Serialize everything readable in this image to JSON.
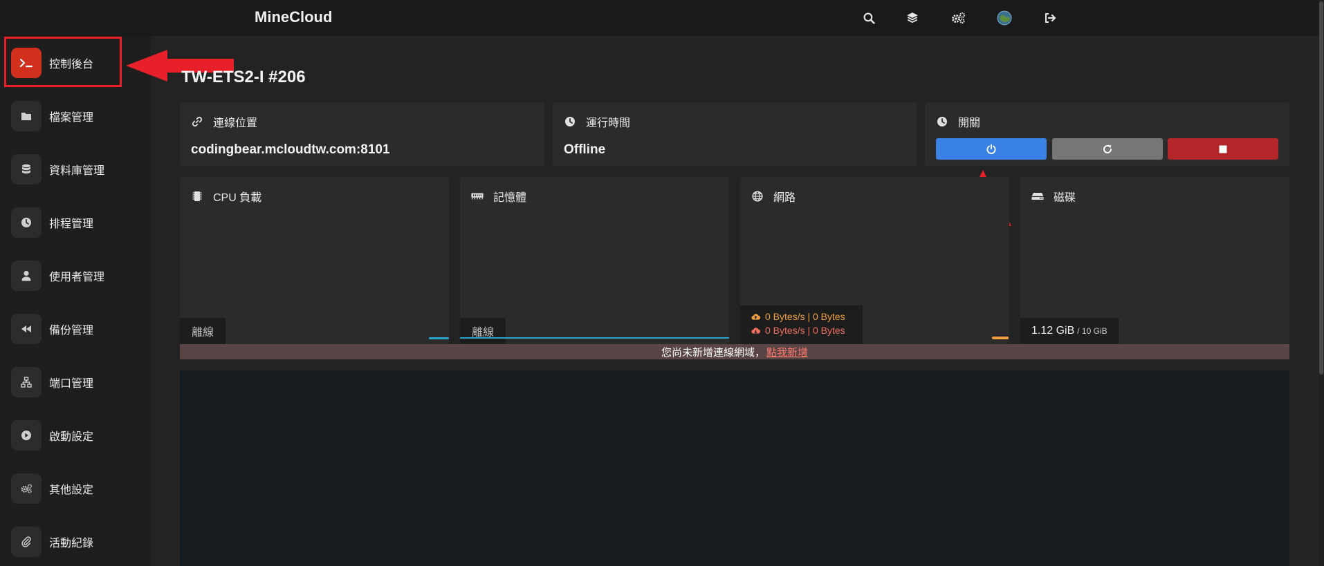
{
  "header": {
    "brand": "MineCloud",
    "icons": [
      "search-icon",
      "layers-icon",
      "cogs-icon",
      "avatar",
      "logout-icon"
    ]
  },
  "sidebar": {
    "items": [
      {
        "label": "控制後台",
        "icon": "terminal-icon",
        "active": true
      },
      {
        "label": "檔案管理",
        "icon": "folder-icon"
      },
      {
        "label": "資料庫管理",
        "icon": "database-icon"
      },
      {
        "label": "排程管理",
        "icon": "clock-icon"
      },
      {
        "label": "使用者管理",
        "icon": "user-icon"
      },
      {
        "label": "備份管理",
        "icon": "backward-icon"
      },
      {
        "label": "端口管理",
        "icon": "network-icon"
      },
      {
        "label": "啟動設定",
        "icon": "play-icon"
      },
      {
        "label": "其他設定",
        "icon": "cogs-icon"
      },
      {
        "label": "活動紀錄",
        "icon": "paperclip-icon"
      }
    ]
  },
  "server": {
    "title": "TW-ETS2-I #206"
  },
  "connection": {
    "label": "連線位置",
    "value": "codingbear.mcloudtw.com:8101"
  },
  "uptime": {
    "label": "運行時間",
    "value": "Offline"
  },
  "power": {
    "label": "開關",
    "buttons": [
      {
        "name": "start",
        "color": "#3b82e6",
        "icon": "power-icon"
      },
      {
        "name": "restart",
        "color": "#767676",
        "icon": "redo-icon"
      },
      {
        "name": "stop",
        "color": "#b3262a",
        "icon": "stop-icon"
      }
    ]
  },
  "stats": {
    "cpu": {
      "label": "CPU 負載",
      "status": "離線"
    },
    "memory": {
      "label": "記憶體",
      "status": "離線"
    },
    "network": {
      "label": "網路",
      "upload": "0 Bytes/s | 0 Bytes",
      "download": "0 Bytes/s | 0 Bytes"
    },
    "disk": {
      "label": "磁碟",
      "used": "1.12 GiB",
      "total": "/ 10 GiB"
    }
  },
  "banner": {
    "text": "您尚未新增連線網域，",
    "link": "點我新增"
  },
  "colors": {
    "accent": "#d2301e",
    "start": "#3b82e6",
    "stop": "#b3262a",
    "annotation": "#e8202a"
  }
}
